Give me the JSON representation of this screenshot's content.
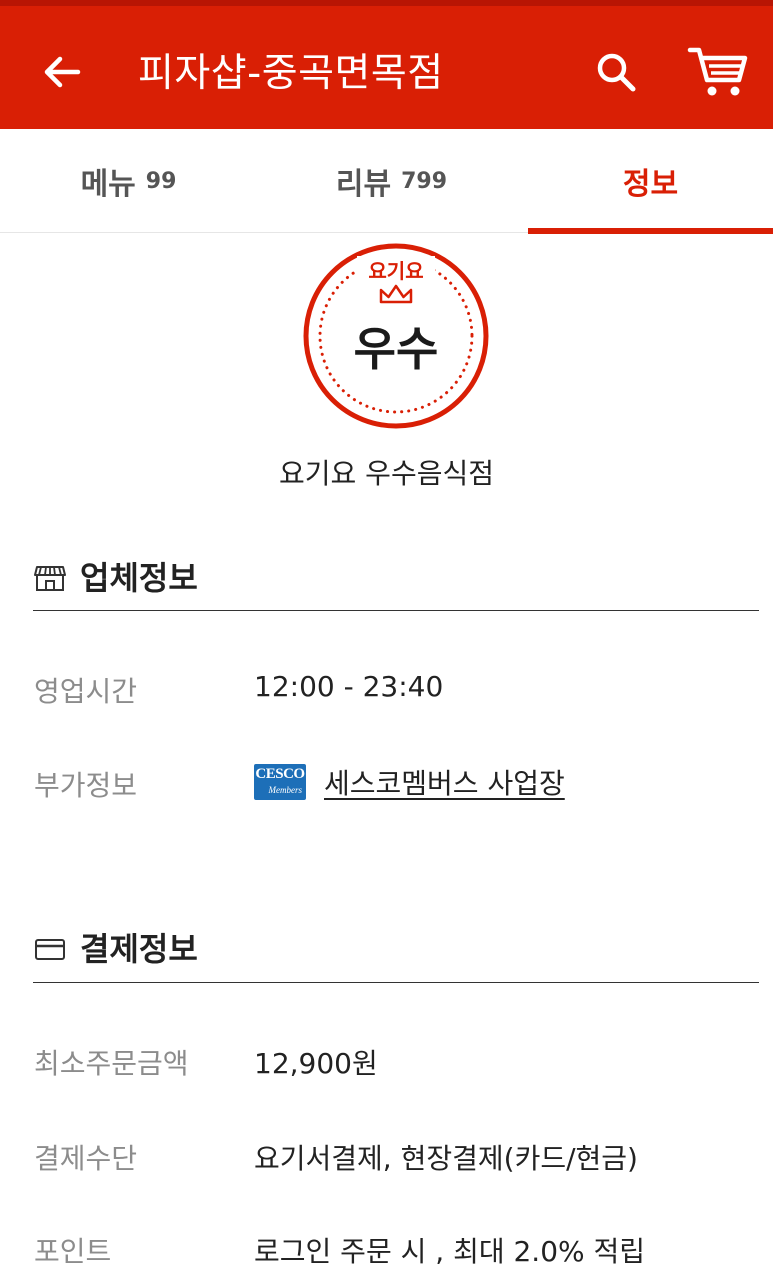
{
  "header": {
    "title": "피자샵-중곡면목점",
    "brand_color": "#d91f05"
  },
  "tabs": [
    {
      "label": "메뉴",
      "count": "99"
    },
    {
      "label": "리뷰",
      "count": "799"
    },
    {
      "label": "정보",
      "count": ""
    }
  ],
  "badge": {
    "top_text": "요기요",
    "main_text": "우수",
    "caption": "요기요 우수음식점"
  },
  "business_info": {
    "title": "업체정보",
    "hours_label": "영업시간",
    "hours_value": "12:00 - 23:40",
    "extra_label": "부가정보",
    "logo_text": "CESCO",
    "logo_subtext": "Members",
    "extra_value": "세스코멤버스 사업장"
  },
  "payment_info": {
    "title": "결제정보",
    "min_order_label": "최소주문금액",
    "min_order_value": "12,900원",
    "method_label": "결제수단",
    "method_value": "요기서결제, 현장결제(카드/현금)",
    "points_label": "포인트",
    "points_value": "로그인 주문 시 , 최대 2.0% 적립"
  }
}
